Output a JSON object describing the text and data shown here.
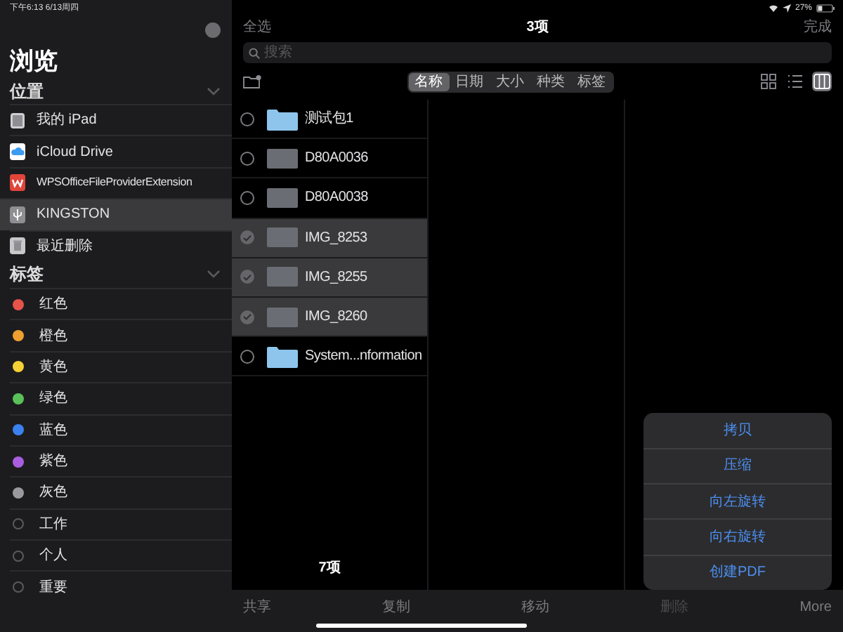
{
  "status_bar": {
    "time": "下午6:13",
    "date": "6/13周四",
    "battery": "27%"
  },
  "sidebar": {
    "title": "浏览",
    "sections": [
      {
        "title": "位置",
        "expanded": true,
        "items": [
          {
            "label": "我的 iPad",
            "kind": "ipad",
            "selected": false
          },
          {
            "label": "iCloud Drive",
            "kind": "cloud",
            "selected": false
          },
          {
            "label": "WPSOfficeFileProviderExtension",
            "kind": "wps",
            "selected": false
          },
          {
            "label": "KINGSTON",
            "kind": "usb",
            "selected": true
          },
          {
            "label": "最近删除",
            "kind": "trash",
            "selected": false
          }
        ]
      },
      {
        "title": "标签",
        "expanded": true,
        "items": [
          {
            "label": "红色",
            "color": "#e5534b"
          },
          {
            "label": "橙色",
            "color": "#f0a030"
          },
          {
            "label": "黄色",
            "color": "#f5d136"
          },
          {
            "label": "绿色",
            "color": "#5ac05a"
          },
          {
            "label": "蓝色",
            "color": "#3b82f0"
          },
          {
            "label": "紫色",
            "color": "#a95ee0"
          },
          {
            "label": "灰色",
            "color": "#9a9a9e"
          },
          {
            "label": "工作"
          },
          {
            "label": "个人"
          },
          {
            "label": "重要"
          }
        ]
      }
    ]
  },
  "header": {
    "select_all": "全选",
    "title": "3项",
    "done": "完成"
  },
  "search": {
    "placeholder": "搜索"
  },
  "sort_tabs": [
    {
      "label": "名称",
      "selected": true
    },
    {
      "label": "日期",
      "selected": false
    },
    {
      "label": "大小",
      "selected": false
    },
    {
      "label": "种类",
      "selected": false
    },
    {
      "label": "标签",
      "selected": false
    }
  ],
  "view_modes": [
    {
      "kind": "grid",
      "selected": false
    },
    {
      "kind": "list",
      "selected": false
    },
    {
      "kind": "columns",
      "selected": true
    }
  ],
  "files": [
    {
      "name": "测试包1",
      "kind": "folder",
      "selected": false
    },
    {
      "name": "D80A0036",
      "kind": "photo",
      "selected": false
    },
    {
      "name": "D80A0038",
      "kind": "photo",
      "selected": false
    },
    {
      "name": "IMG_8253",
      "kind": "photo",
      "selected": true
    },
    {
      "name": "IMG_8255",
      "kind": "photo",
      "selected": true
    },
    {
      "name": "IMG_8260",
      "kind": "photo",
      "selected": true
    },
    {
      "name": "System...nformation",
      "kind": "folder",
      "selected": false
    }
  ],
  "item_count": "7项",
  "toolbar": [
    {
      "label": "共享",
      "disabled": false
    },
    {
      "label": "复制",
      "disabled": false
    },
    {
      "label": "移动",
      "disabled": false
    },
    {
      "label": "删除",
      "disabled": true
    },
    {
      "label": "More",
      "disabled": false
    }
  ],
  "menu": [
    "拷贝",
    "压缩",
    "向左旋转",
    "向右旋转",
    "创建PDF"
  ]
}
